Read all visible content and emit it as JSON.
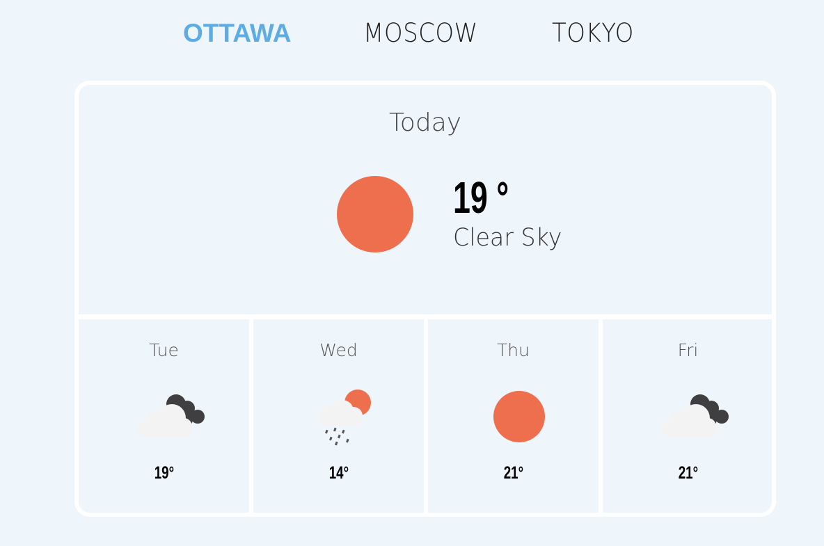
{
  "tabs": [
    {
      "label": "OTTAWA",
      "active": true
    },
    {
      "label": "MOSCOW",
      "active": false
    },
    {
      "label": "TOKYO",
      "active": false
    }
  ],
  "today": {
    "title": "Today",
    "temperature": "19 °",
    "description": "Clear Sky",
    "icon": "sun-icon"
  },
  "forecast": [
    {
      "day": "Tue",
      "temperature": "19°",
      "icon": "cloudy-icon"
    },
    {
      "day": "Wed",
      "temperature": "14°",
      "icon": "rain-sun-icon"
    },
    {
      "day": "Thu",
      "temperature": "21°",
      "icon": "sun-icon"
    },
    {
      "day": "Fri",
      "temperature": "21°",
      "icon": "cloudy-icon"
    }
  ],
  "colors": {
    "background": "#eef5fb",
    "accent": "#5dade2",
    "sun": "#ee6f4e",
    "dark_cloud": "#3f3f41",
    "light_cloud": "#f3f3f3"
  }
}
